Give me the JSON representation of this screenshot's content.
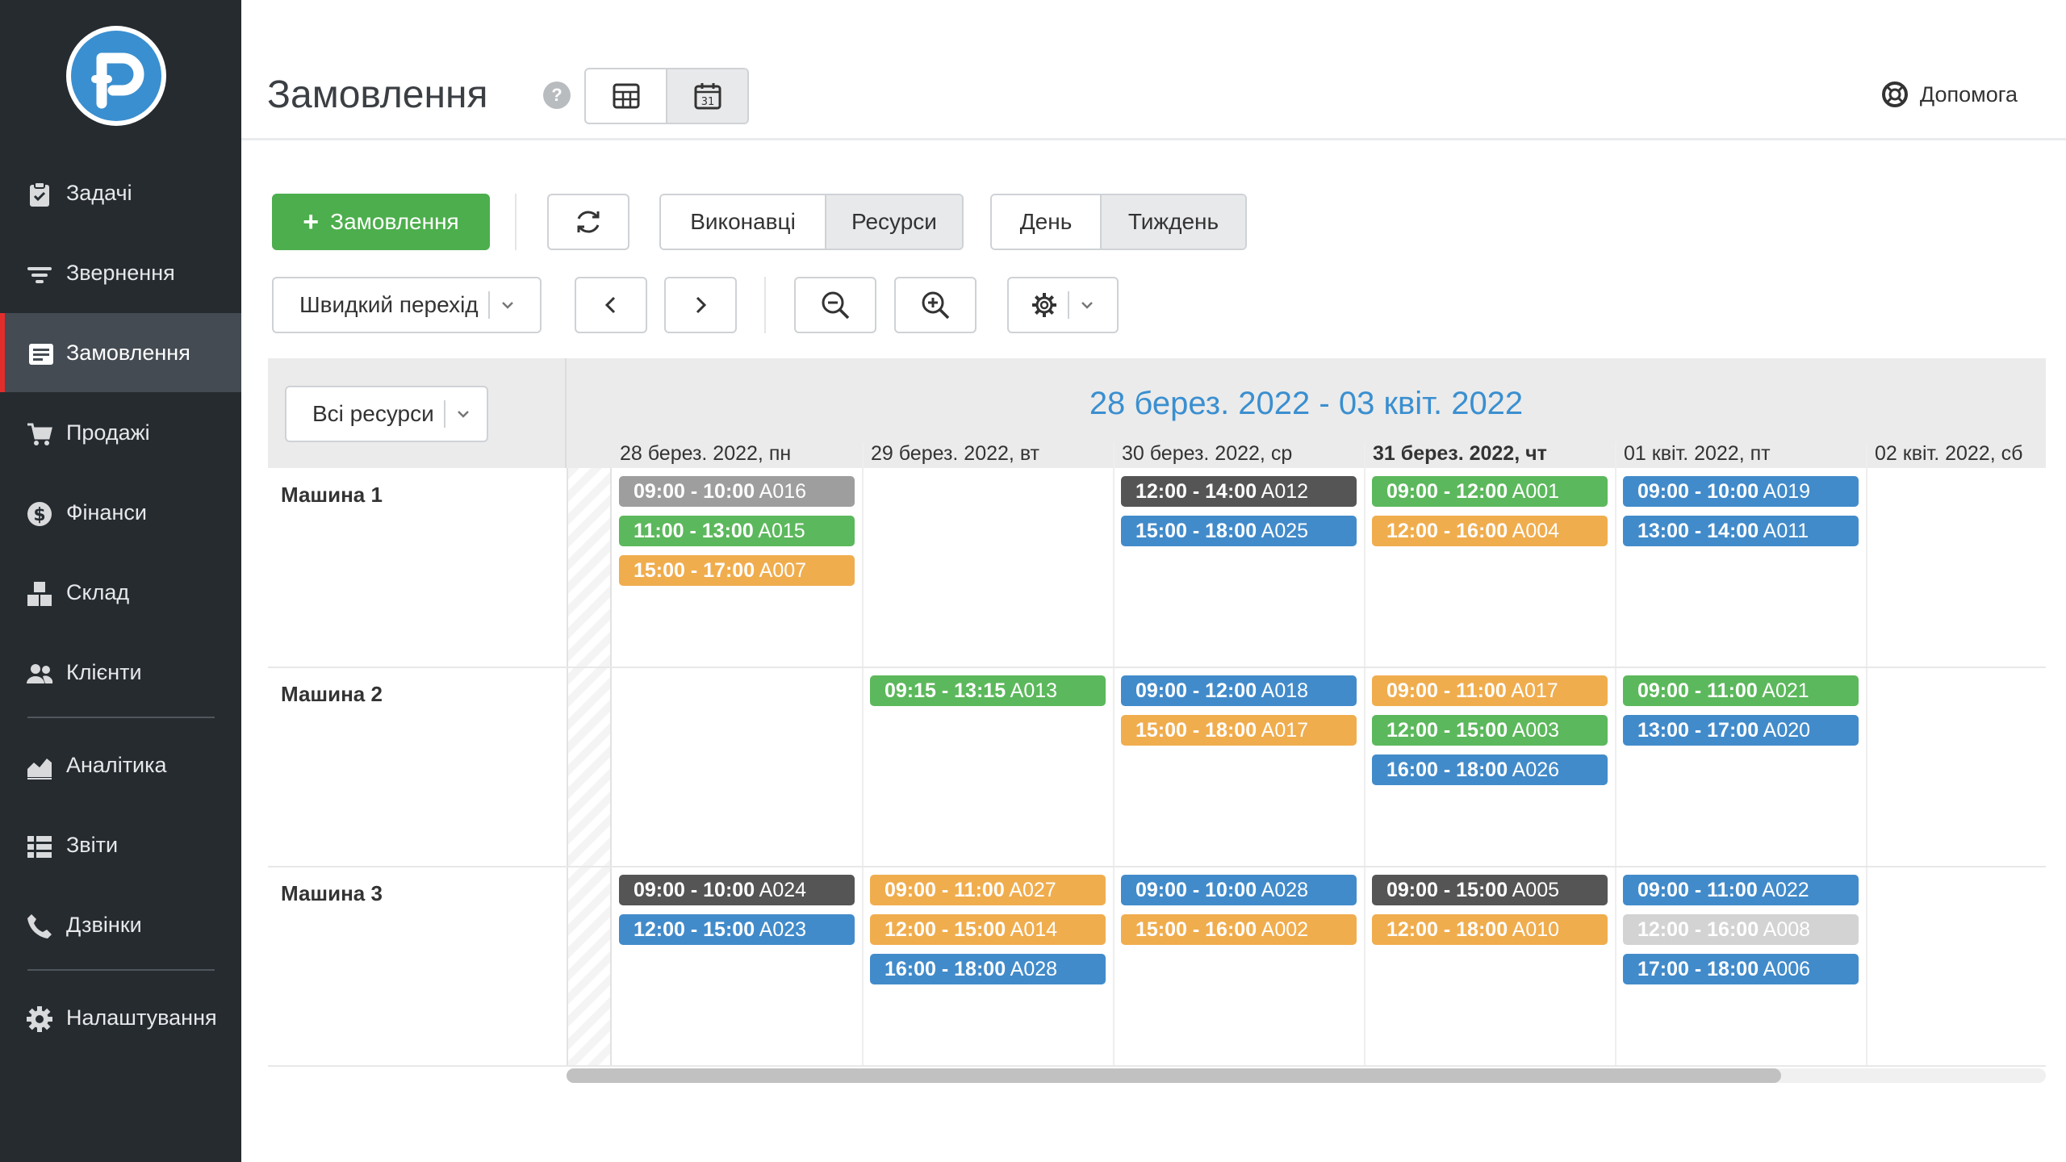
{
  "sidebar": {
    "logo": "P",
    "items": [
      {
        "label": "Задачі",
        "icon": "clipboard-check-icon"
      },
      {
        "label": "Звернення",
        "icon": "filter-icon"
      },
      {
        "label": "Замовлення",
        "icon": "order-card-icon",
        "active": true
      },
      {
        "label": "Продажі",
        "icon": "cart-icon"
      },
      {
        "label": "Фінанси",
        "icon": "dollar-circle-icon"
      },
      {
        "label": "Склад",
        "icon": "boxes-icon"
      },
      {
        "label": "Клієнти",
        "icon": "users-icon"
      },
      {
        "label": "Аналітика",
        "icon": "area-chart-icon"
      },
      {
        "label": "Звіти",
        "icon": "list-icon"
      },
      {
        "label": "Дзвінки",
        "icon": "phone-icon"
      },
      {
        "label": "Налаштування",
        "icon": "gear-icon"
      }
    ]
  },
  "header": {
    "title": "Замовлення",
    "help_mark": "?",
    "calendar_day": "31",
    "help_label": "Допомога"
  },
  "toolbar": {
    "add_label": "Замовлення",
    "add_plus": "+",
    "mode_executors": "Виконавці",
    "mode_resources": "Ресурси",
    "view_day": "День",
    "view_week": "Тиждень",
    "quick_jump": "Швидкий перехід"
  },
  "scheduler": {
    "resource_filter": "Всі ресурси",
    "range_title": "28 берез. 2022 - 03 квіт. 2022",
    "days": [
      {
        "label": "28 берез. 2022, пн",
        "today": false
      },
      {
        "label": "29 берез. 2022, вт",
        "today": false
      },
      {
        "label": "30 берез. 2022, ср",
        "today": false
      },
      {
        "label": "31 берез. 2022, чт",
        "today": true
      },
      {
        "label": "01 квіт. 2022, пт",
        "today": false
      },
      {
        "label": "02 квіт. 2022, сб",
        "today": false
      }
    ],
    "resources": [
      "Машина 1",
      "Машина 2",
      "Машина 3"
    ],
    "colors": {
      "gray": "#9e9e9e",
      "green": "#5cb85c",
      "orange": "#f0ad4e",
      "blue": "#428bca",
      "dark": "#555555",
      "light": "#d3d3d3"
    },
    "events": [
      {
        "resource": 0,
        "day": 0,
        "slot": 0,
        "time": "09:00 - 10:00",
        "code": "A016",
        "color": "gray"
      },
      {
        "resource": 0,
        "day": 0,
        "slot": 1,
        "time": "11:00 - 13:00",
        "code": "A015",
        "color": "green"
      },
      {
        "resource": 0,
        "day": 0,
        "slot": 2,
        "time": "15:00 - 17:00",
        "code": "A007",
        "color": "orange"
      },
      {
        "resource": 0,
        "day": 2,
        "slot": 0,
        "time": "12:00 - 14:00",
        "code": "A012",
        "color": "dark"
      },
      {
        "resource": 0,
        "day": 2,
        "slot": 1,
        "time": "15:00 - 18:00",
        "code": "A025",
        "color": "blue"
      },
      {
        "resource": 0,
        "day": 3,
        "slot": 0,
        "time": "09:00 - 12:00",
        "code": "A001",
        "color": "green"
      },
      {
        "resource": 0,
        "day": 3,
        "slot": 1,
        "time": "12:00 - 16:00",
        "code": "A004",
        "color": "orange"
      },
      {
        "resource": 0,
        "day": 4,
        "slot": 0,
        "time": "09:00 - 10:00",
        "code": "A019",
        "color": "blue"
      },
      {
        "resource": 0,
        "day": 4,
        "slot": 1,
        "time": "13:00 - 14:00",
        "code": "A011",
        "color": "blue"
      },
      {
        "resource": 1,
        "day": 1,
        "slot": 0,
        "time": "09:15 - 13:15",
        "code": "A013",
        "color": "green"
      },
      {
        "resource": 1,
        "day": 2,
        "slot": 0,
        "time": "09:00 - 12:00",
        "code": "A018",
        "color": "blue"
      },
      {
        "resource": 1,
        "day": 2,
        "slot": 1,
        "time": "15:00 - 18:00",
        "code": "A017",
        "color": "orange"
      },
      {
        "resource": 1,
        "day": 3,
        "slot": 0,
        "time": "09:00 - 11:00",
        "code": "A017",
        "color": "orange"
      },
      {
        "resource": 1,
        "day": 3,
        "slot": 1,
        "time": "12:00 - 15:00",
        "code": "A003",
        "color": "green"
      },
      {
        "resource": 1,
        "day": 3,
        "slot": 2,
        "time": "16:00 - 18:00",
        "code": "A026",
        "color": "blue"
      },
      {
        "resource": 1,
        "day": 4,
        "slot": 0,
        "time": "09:00 - 11:00",
        "code": "A021",
        "color": "green"
      },
      {
        "resource": 1,
        "day": 4,
        "slot": 1,
        "time": "13:00 - 17:00",
        "code": "A020",
        "color": "blue"
      },
      {
        "resource": 2,
        "day": 0,
        "slot": 0,
        "time": "09:00 - 10:00",
        "code": "A024",
        "color": "dark"
      },
      {
        "resource": 2,
        "day": 0,
        "slot": 1,
        "time": "12:00 - 15:00",
        "code": "A023",
        "color": "blue"
      },
      {
        "resource": 2,
        "day": 1,
        "slot": 0,
        "time": "09:00 - 11:00",
        "code": "A027",
        "color": "orange"
      },
      {
        "resource": 2,
        "day": 1,
        "slot": 1,
        "time": "12:00 - 15:00",
        "code": "A014",
        "color": "orange"
      },
      {
        "resource": 2,
        "day": 1,
        "slot": 2,
        "time": "16:00 - 18:00",
        "code": "A028",
        "color": "blue"
      },
      {
        "resource": 2,
        "day": 2,
        "slot": 0,
        "time": "09:00 - 10:00",
        "code": "A028",
        "color": "blue"
      },
      {
        "resource": 2,
        "day": 2,
        "slot": 1,
        "time": "15:00 - 16:00",
        "code": "A002",
        "color": "orange"
      },
      {
        "resource": 2,
        "day": 3,
        "slot": 0,
        "time": "09:00 - 15:00",
        "code": "A005",
        "color": "dark"
      },
      {
        "resource": 2,
        "day": 3,
        "slot": 1,
        "time": "12:00 - 18:00",
        "code": "A010",
        "color": "orange"
      },
      {
        "resource": 2,
        "day": 4,
        "slot": 0,
        "time": "09:00 - 11:00",
        "code": "A022",
        "color": "blue"
      },
      {
        "resource": 2,
        "day": 4,
        "slot": 1,
        "time": "12:00 - 16:00",
        "code": "A008",
        "color": "light"
      },
      {
        "resource": 2,
        "day": 4,
        "slot": 2,
        "time": "17:00 - 18:00",
        "code": "A006",
        "color": "blue"
      }
    ]
  }
}
